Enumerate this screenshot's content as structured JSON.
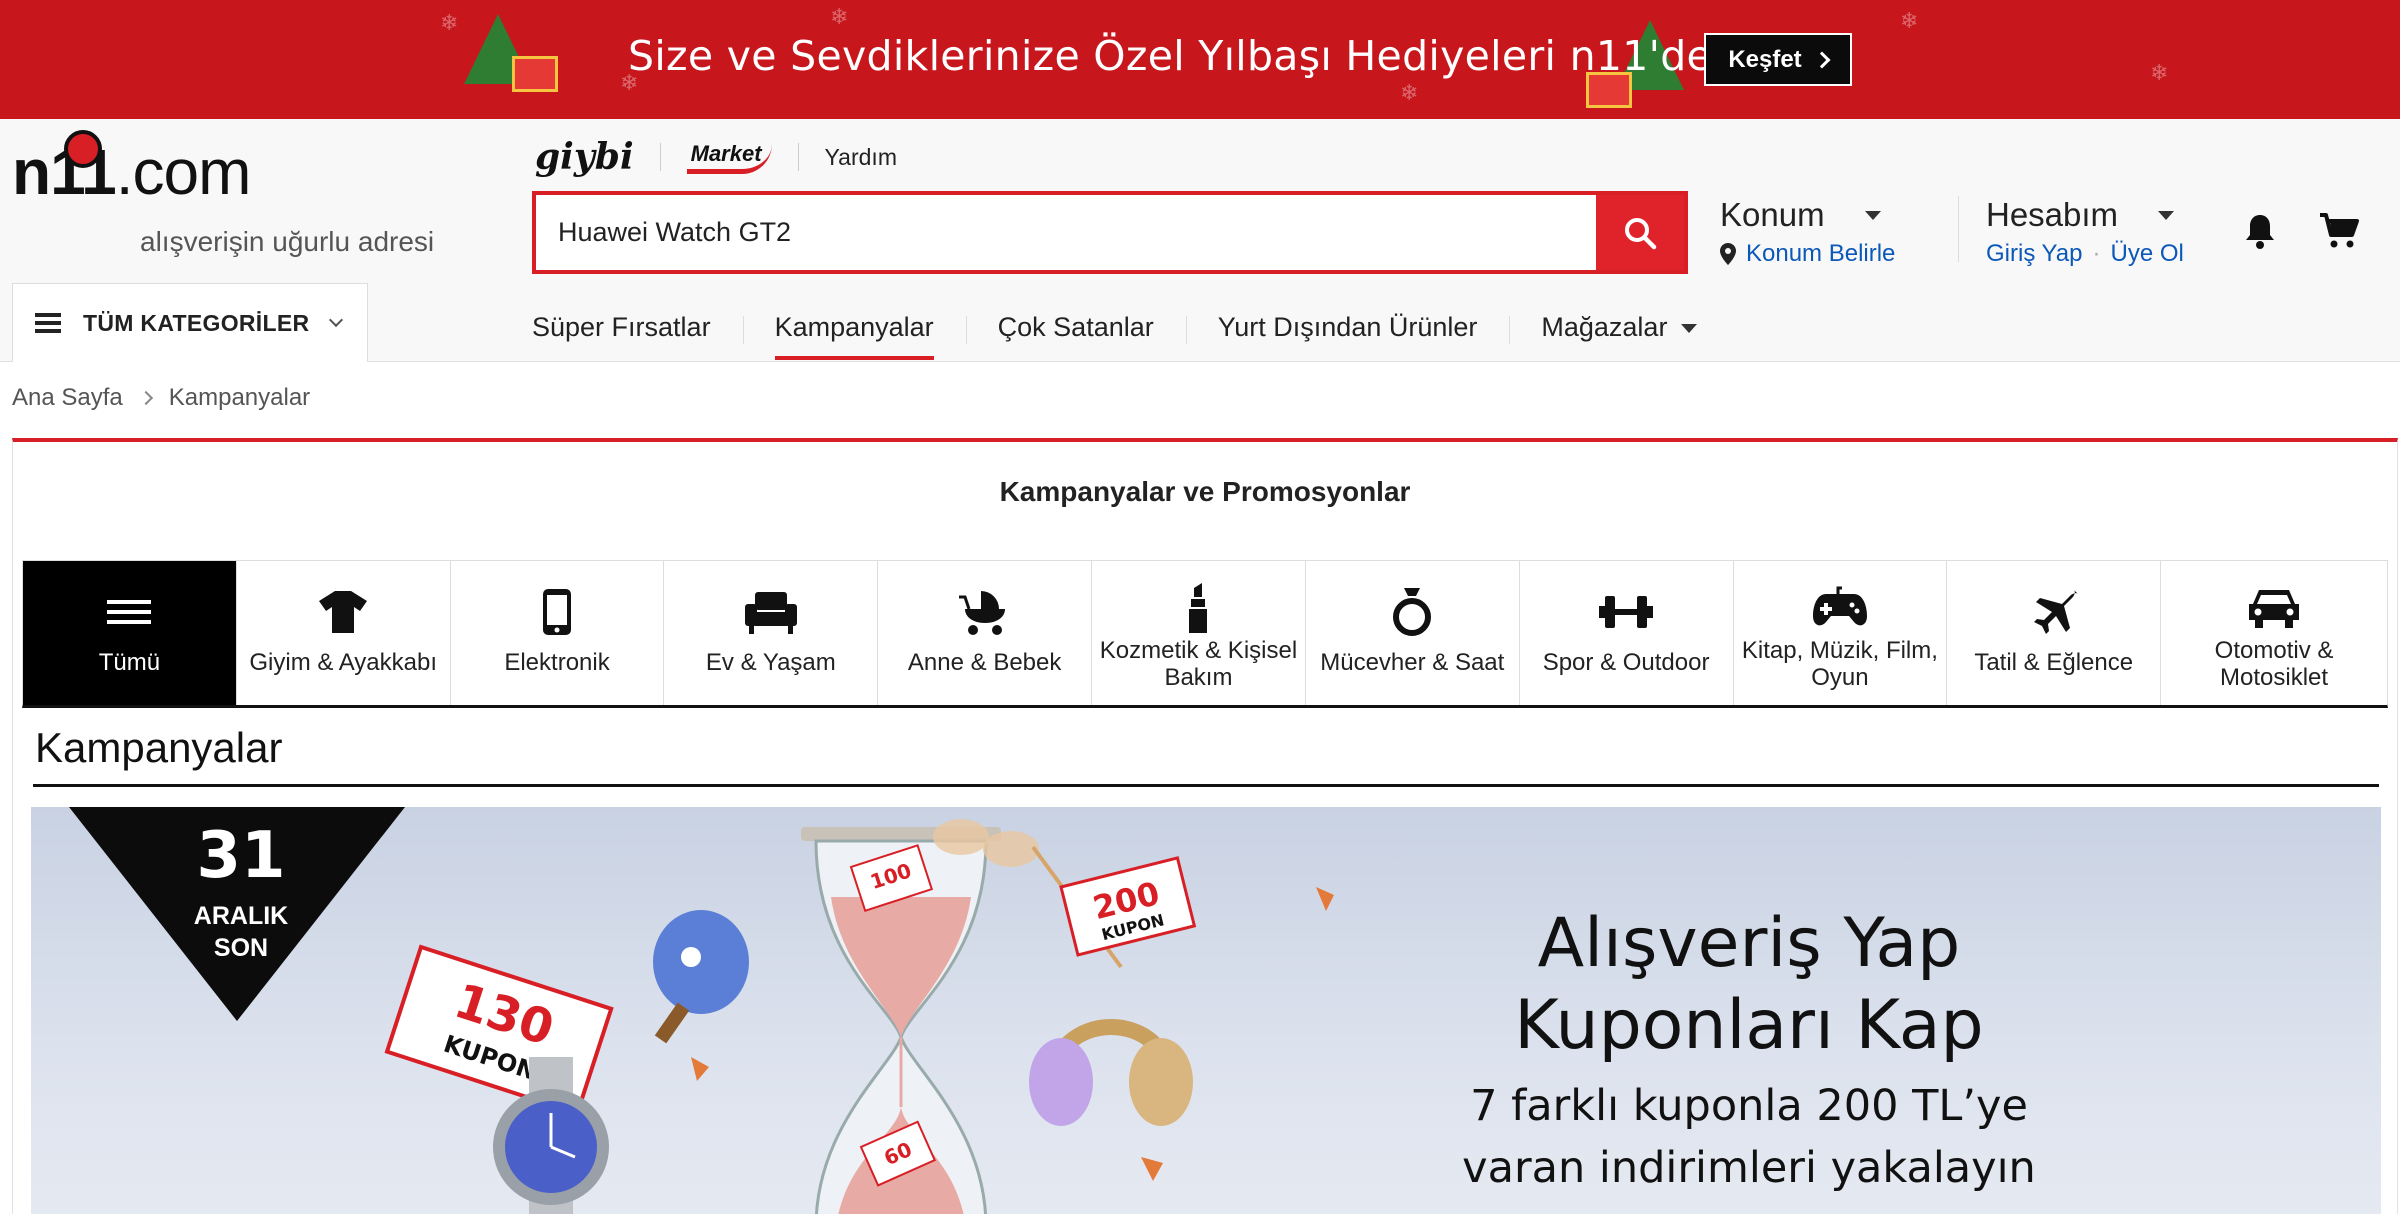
{
  "promo": {
    "text": "Size ve Sevdiklerinize Özel Yılbaşı Hediyeleri n11'de",
    "button_label": "Keşfet"
  },
  "header": {
    "logo": {
      "brand": "n11",
      "suffix": ".com",
      "tagline": "alışverişin uğurlu adresi"
    },
    "sub_links": {
      "giybi": "giybi",
      "market": "Market",
      "help": "Yardım"
    },
    "search": {
      "value": "Huawei Watch GT2",
      "placeholder": ""
    },
    "location": {
      "title": "Konum",
      "action": "Konum Belirle"
    },
    "account": {
      "title": "Hesabım",
      "login": "Giriş Yap",
      "register": "Üye Ol"
    },
    "all_categories_label": "TÜM KATEGORİLER",
    "nav": [
      {
        "label": "Süper Fırsatlar"
      },
      {
        "label": "Kampanyalar"
      },
      {
        "label": "Çok Satanlar"
      },
      {
        "label": "Yurt Dışından Ürünler"
      },
      {
        "label": "Mağazalar"
      }
    ],
    "accent_color": "#d81f26",
    "link_color": "#0c58b8"
  },
  "breadcrumb": {
    "home": "Ana Sayfa",
    "current": "Kampanyalar"
  },
  "content": {
    "title": "Kampanyalar ve Promosyonlar",
    "categories": [
      {
        "name": "Tümü",
        "icon": "list-icon"
      },
      {
        "name": "Giyim & Ayakkabı",
        "icon": "tshirt-icon"
      },
      {
        "name": "Elektronik",
        "icon": "phone-icon"
      },
      {
        "name": "Ev & Yaşam",
        "icon": "armchair-icon"
      },
      {
        "name": "Anne & Bebek",
        "icon": "stroller-icon"
      },
      {
        "name": "Kozmetik & Kişisel Bakım",
        "icon": "lipstick-icon"
      },
      {
        "name": "Mücevher & Saat",
        "icon": "ring-icon"
      },
      {
        "name": "Spor & Outdoor",
        "icon": "dumbbell-icon"
      },
      {
        "name": "Kitap, Müzik, Film, Oyun",
        "icon": "gamepad-icon"
      },
      {
        "name": "Tatil & Eğlence",
        "icon": "airplane-icon"
      },
      {
        "name": "Otomotiv & Motosiklet",
        "icon": "car-icon"
      }
    ],
    "section_title": "Kampanyalar",
    "hero": {
      "date_day": "31",
      "date_month": "ARALIK",
      "date_suffix": "SON",
      "headline_line1": "Alışveriş Yap",
      "headline_line2": "Kuponları Kap",
      "sub_line1": "7 farklı kuponla 200 TL’ye",
      "sub_line2": "varan indirimleri yakalayın",
      "coupon_labels": [
        "130TL KUPON",
        "100TL KUPON",
        "200TL KUPON",
        "60TL KUPON"
      ]
    }
  }
}
